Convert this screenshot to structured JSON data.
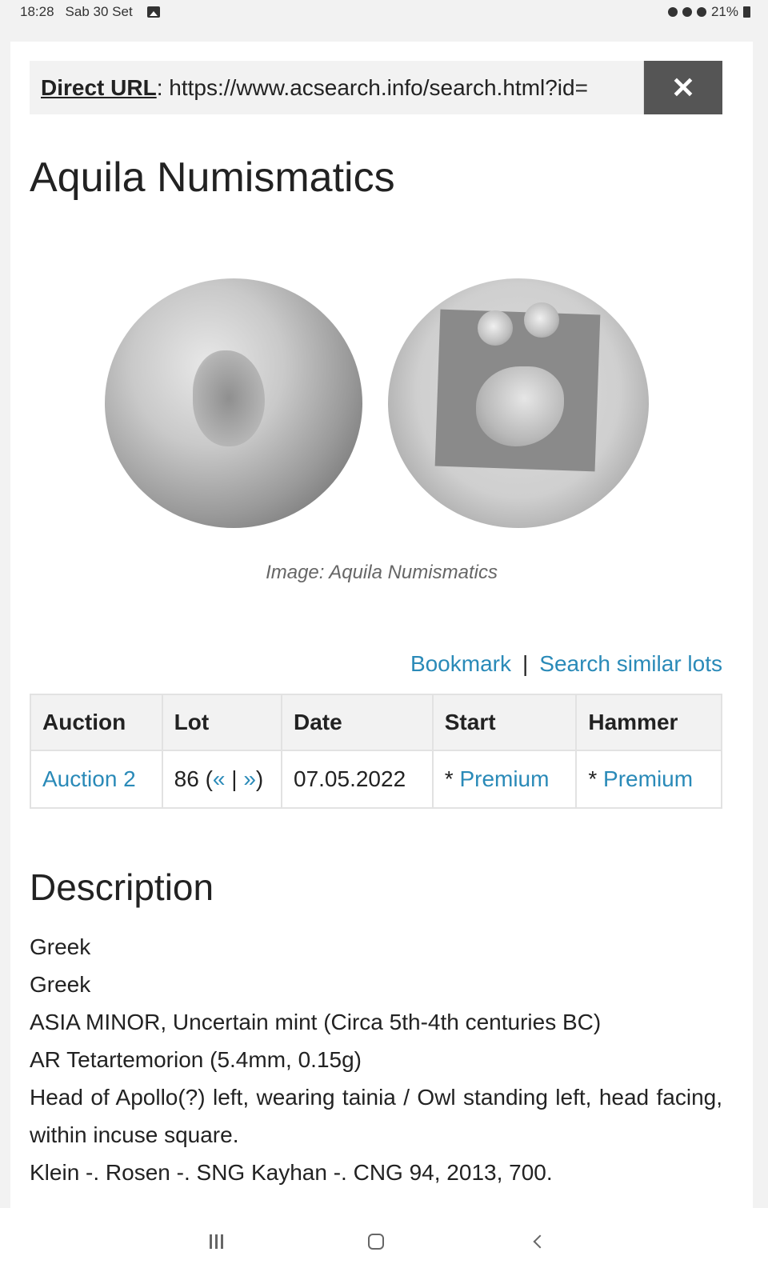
{
  "status_bar": {
    "time": "18:28",
    "date": "Sab 30 Set",
    "battery": "21%"
  },
  "url_bar": {
    "label": "Direct URL",
    "separator": ": ",
    "value": "https://www.acsearch.info/search.html?id="
  },
  "close_label": "✕",
  "page_title": "Aquila Numismatics",
  "image_caption": "Image: Aquila Numismatics",
  "links": {
    "bookmark": "Bookmark",
    "separator": "|",
    "search_similar": "Search similar lots"
  },
  "table": {
    "headers": [
      "Auction",
      "Lot",
      "Date",
      "Start",
      "Hammer"
    ],
    "row": {
      "auction": "Auction 2",
      "lot_number": "86 (",
      "lot_prev": "«",
      "lot_sep": " | ",
      "lot_next": "»",
      "lot_close": ")",
      "date": "07.05.2022",
      "start_prefix": "* ",
      "start_link": "Premium",
      "hammer_prefix": "* ",
      "hammer_link": "Premium"
    }
  },
  "description": {
    "title": "Description",
    "lines": [
      "Greek",
      "Greek",
      "ASIA MINOR, Uncertain mint (Circa 5th-4th centuries BC)",
      "AR Tetartemorion (5.4mm, 0.15g)",
      "Head of Apollo(?) left, wearing tainia / Owl standing left, head facing, within incuse square.",
      "Klein -. Rosen -. SNG Kayhan -. CNG 94, 2013, 700."
    ]
  },
  "colors": {
    "link": "#2a8ab8",
    "close_button_bg": "#555555"
  },
  "icons": [
    "gallery-icon",
    "alarm-icon",
    "mute-icon",
    "wifi-icon",
    "battery-icon",
    "close-icon",
    "recents-icon",
    "home-icon",
    "back-icon"
  ]
}
